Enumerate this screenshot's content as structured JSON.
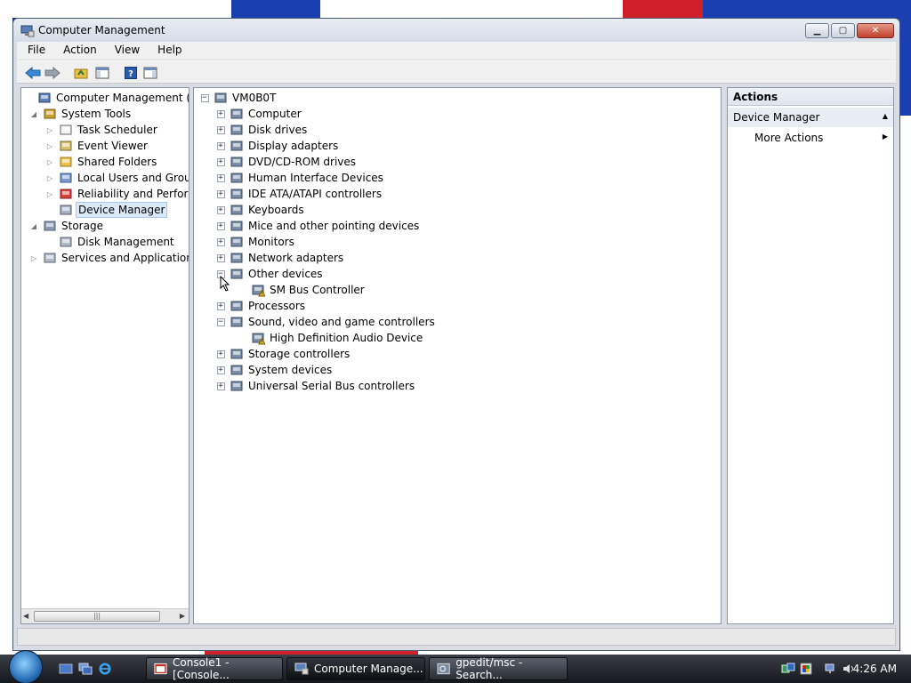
{
  "window": {
    "title": "Computer Management"
  },
  "menu": {
    "items": [
      "File",
      "Action",
      "View",
      "Help"
    ]
  },
  "left_tree": {
    "items": [
      {
        "label": "Computer Management (Local",
        "icon": "computer-management-icon",
        "level": 0
      },
      {
        "label": "System Tools",
        "icon": "system-tools-icon",
        "level": 1
      },
      {
        "label": "Task Scheduler",
        "icon": "clock-icon",
        "level": 2
      },
      {
        "label": "Event Viewer",
        "icon": "event-viewer-icon",
        "level": 2
      },
      {
        "label": "Shared Folders",
        "icon": "shared-folder-icon",
        "level": 2
      },
      {
        "label": "Local Users and Groups",
        "icon": "users-icon",
        "level": 2
      },
      {
        "label": "Reliability and Performa",
        "icon": "reliability-icon",
        "level": 2
      },
      {
        "label": "Device Manager",
        "icon": "device-manager-icon",
        "level": 2,
        "selected": true
      },
      {
        "label": "Storage",
        "icon": "storage-icon",
        "level": 1
      },
      {
        "label": "Disk Management",
        "icon": "disk-icon",
        "level": 2
      },
      {
        "label": "Services and Applications",
        "icon": "services-icon",
        "level": 1
      }
    ]
  },
  "device_tree": {
    "root": "VM0B0T",
    "categories": [
      {
        "label": "Computer",
        "icon": "computer-icon"
      },
      {
        "label": "Disk drives",
        "icon": "disk-drive-icon"
      },
      {
        "label": "Display adapters",
        "icon": "display-icon"
      },
      {
        "label": "DVD/CD-ROM drives",
        "icon": "dvd-icon"
      },
      {
        "label": "Human Interface Devices",
        "icon": "hid-icon"
      },
      {
        "label": "IDE ATA/ATAPI controllers",
        "icon": "ide-icon"
      },
      {
        "label": "Keyboards",
        "icon": "keyboard-icon"
      },
      {
        "label": "Mice and other pointing devices",
        "icon": "mouse-icon"
      },
      {
        "label": "Monitors",
        "icon": "monitor-icon"
      },
      {
        "label": "Network adapters",
        "icon": "network-icon"
      },
      {
        "label": "Other devices",
        "icon": "unknown-device-icon",
        "expanded": true,
        "children": [
          "SM Bus Controller"
        ]
      },
      {
        "label": "Processors",
        "icon": "processor-icon"
      },
      {
        "label": "Sound, video and game controllers",
        "icon": "speaker-icon",
        "expanded": true,
        "children": [
          "High Definition Audio Device"
        ]
      },
      {
        "label": "Storage controllers",
        "icon": "storage-controller-icon"
      },
      {
        "label": "System devices",
        "icon": "system-device-icon"
      },
      {
        "label": "Universal Serial Bus controllers",
        "icon": "usb-icon"
      }
    ]
  },
  "actions": {
    "header": "Actions",
    "section": "Device Manager",
    "item": "More Actions"
  },
  "taskbar": {
    "tasks": [
      "Console1 - [Console...",
      "Computer Manage...",
      "gpedit/msc - Search..."
    ],
    "active_task": 1,
    "clock": "4:26 AM"
  },
  "colors": {
    "selection": "#dbe9f8",
    "warning": "#f2c40f",
    "taskbar": "#1e2228"
  }
}
